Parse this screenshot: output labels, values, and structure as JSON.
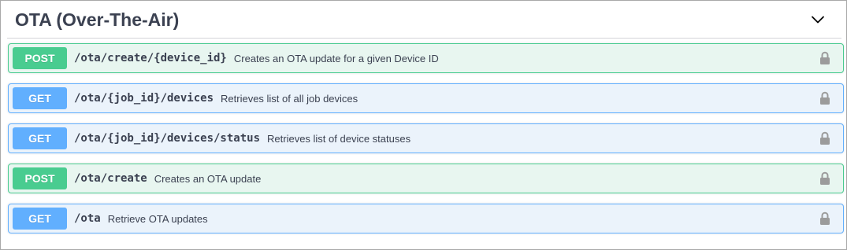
{
  "section": {
    "title": "OTA (Over-The-Air)",
    "toggle_icon": "chevron-down-icon"
  },
  "colors": {
    "post": "#49cc90",
    "get": "#61affe",
    "text": "#3b4151",
    "lock": "#9b9b9b"
  },
  "operations": [
    {
      "method": "POST",
      "path": "/ota/create/{device_id}",
      "description": "Creates an OTA update for a given Device ID",
      "icon": "lock-icon"
    },
    {
      "method": "GET",
      "path": "/ota/{job_id}/devices",
      "description": "Retrieves list of all job devices",
      "icon": "lock-icon"
    },
    {
      "method": "GET",
      "path": "/ota/{job_id}/devices/status",
      "description": "Retrieves list of device statuses",
      "icon": "lock-icon"
    },
    {
      "method": "POST",
      "path": "/ota/create",
      "description": "Creates an OTA update",
      "icon": "lock-icon"
    },
    {
      "method": "GET",
      "path": "/ota",
      "description": "Retrieve OTA updates",
      "icon": "lock-icon"
    }
  ]
}
